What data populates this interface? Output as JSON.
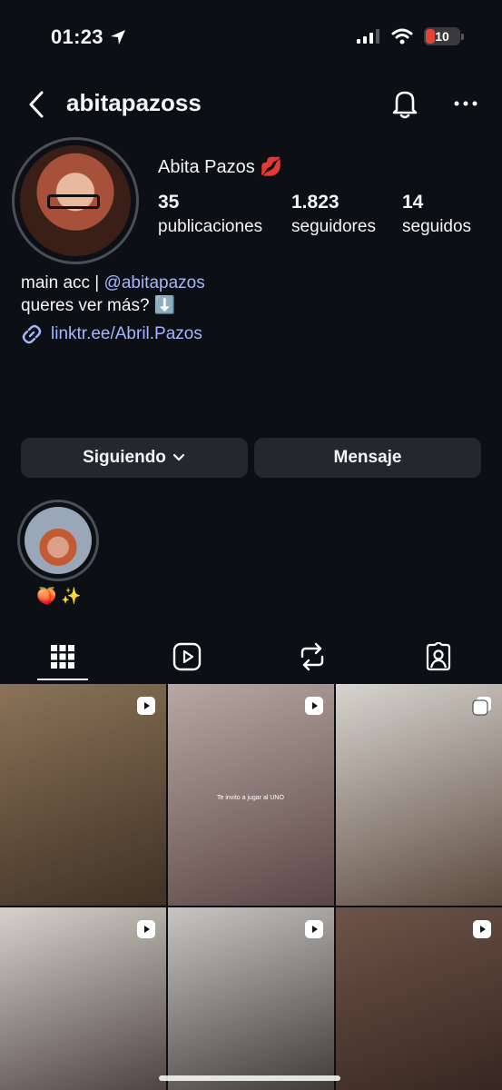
{
  "status": {
    "time": "01:23",
    "battery": "10",
    "battery_color": "#e0443a"
  },
  "header": {
    "username": "abitapazoss"
  },
  "profile": {
    "display_name": "Abita Pazos 💋",
    "stats": [
      {
        "value": "35",
        "label": "publicaciones"
      },
      {
        "value": "1.823",
        "label": "seguidores"
      },
      {
        "value": "14",
        "label": "seguidos"
      }
    ],
    "bio_line1_prefix": "main acc | ",
    "bio_mention": "@abitapazos",
    "bio_line2": "queres ver más? ⬇️",
    "link": "linktr.ee/Abril.Pazos"
  },
  "actions": {
    "following_label": "Siguiendo",
    "message_label": "Mensaje"
  },
  "highlights": [
    {
      "label": "🍑 ✨"
    }
  ],
  "tabs": [
    {
      "icon": "grid-icon",
      "active": true
    },
    {
      "icon": "reels-icon",
      "active": false
    },
    {
      "icon": "reposts-icon",
      "active": false
    },
    {
      "icon": "tagged-icon",
      "active": false
    }
  ],
  "posts": [
    {
      "badge": "reel-icon",
      "tone": [
        "#8a7358",
        "#3f3124"
      ]
    },
    {
      "badge": "reel-icon",
      "tone": [
        "#b9a7a3",
        "#5a4745"
      ],
      "caption": "Te invito a jugar al UNO"
    },
    {
      "badge": "carousel-icon",
      "tone": [
        "#d8d4cf",
        "#5b4a3f"
      ]
    },
    {
      "badge": "reel-icon",
      "tone": [
        "#d6d2cb",
        "#3a2e2a"
      ]
    },
    {
      "badge": "reel-icon",
      "tone": [
        "#c8c6c3",
        "#2a2523"
      ]
    },
    {
      "badge": "reel-icon",
      "tone": [
        "#6e5448",
        "#2d1f1a"
      ]
    }
  ],
  "colors": {
    "background": "#0c1014",
    "button": "#24282e",
    "link": "#a3b6ff"
  }
}
